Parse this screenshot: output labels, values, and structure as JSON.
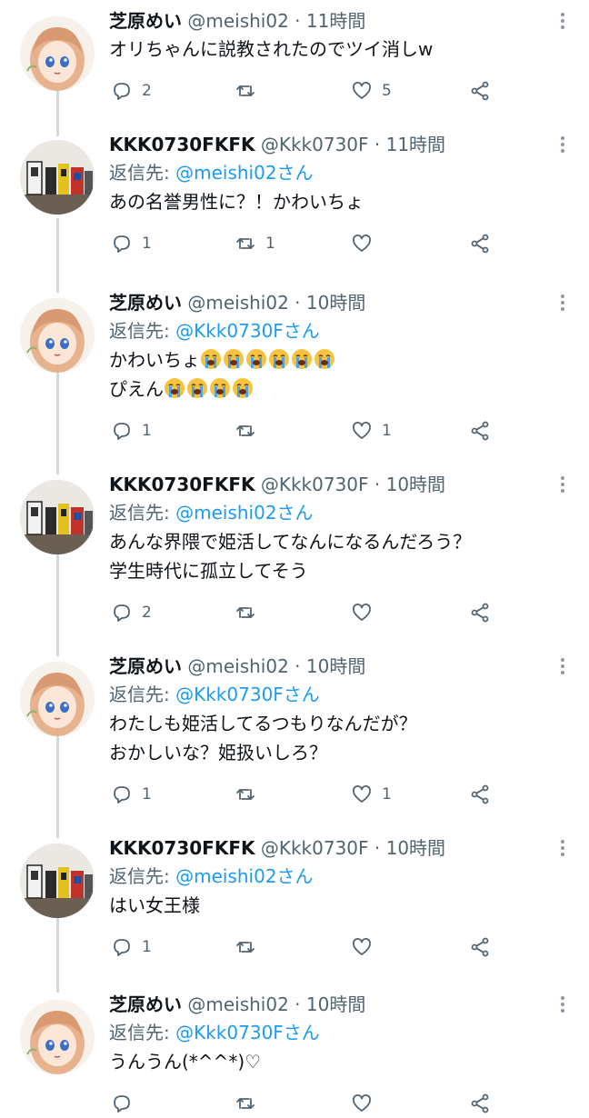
{
  "tweets": [
    {
      "name": "芝原めい",
      "handle": "@meishi02",
      "dot": "·",
      "time": "11時間",
      "reply_prefix": "",
      "reply_mention": "",
      "lines": [
        "オリちゃんに説教されたのでツイ消しw"
      ],
      "reply_count": "2",
      "retweet_count": "",
      "like_count": "5",
      "avatar": "anime-girl-avatar"
    },
    {
      "name": "KKK0730FKFK",
      "handle": "@Kkk0730F",
      "dot": "·",
      "time": "11時間",
      "reply_prefix": "返信先: ",
      "reply_mention": "@meishi02さん",
      "lines": [
        "あの名誉男性に？！かわいちょ"
      ],
      "reply_count": "1",
      "retweet_count": "1",
      "like_count": "",
      "avatar": "robot-figures-avatar"
    },
    {
      "name": "芝原めい",
      "handle": "@meishi02",
      "dot": "·",
      "time": "10時間",
      "reply_prefix": "返信先: ",
      "reply_mention": "@Kkk0730Fさん",
      "lines": [
        "かわいちょ",
        "ぴえん"
      ],
      "emoji_counts": [
        6,
        4
      ],
      "emoji_name": "loudly-crying-face",
      "reply_count": "1",
      "retweet_count": "",
      "like_count": "1",
      "avatar": "anime-girl-avatar"
    },
    {
      "name": "KKK0730FKFK",
      "handle": "@Kkk0730F",
      "dot": "·",
      "time": "10時間",
      "reply_prefix": "返信先: ",
      "reply_mention": "@meishi02さん",
      "lines": [
        "あんな界隈で姫活してなんになるんだろう？",
        "学生時代に孤立してそう"
      ],
      "reply_count": "2",
      "retweet_count": "",
      "like_count": "",
      "avatar": "robot-figures-avatar"
    },
    {
      "name": "芝原めい",
      "handle": "@meishi02",
      "dot": "·",
      "time": "10時間",
      "reply_prefix": "返信先: ",
      "reply_mention": "@Kkk0730Fさん",
      "lines": [
        "わたしも姫活してるつもりなんだが？",
        "おかしいな？姫扱いしろ？"
      ],
      "reply_count": "1",
      "retweet_count": "",
      "like_count": "1",
      "avatar": "anime-girl-avatar"
    },
    {
      "name": "KKK0730FKFK",
      "handle": "@Kkk0730F",
      "dot": "·",
      "time": "10時間",
      "reply_prefix": "返信先: ",
      "reply_mention": "@meishi02さん",
      "lines": [
        "はい女王様"
      ],
      "reply_count": "1",
      "retweet_count": "",
      "like_count": "",
      "avatar": "robot-figures-avatar"
    },
    {
      "name": "芝原めい",
      "handle": "@meishi02",
      "dot": "·",
      "time": "10時間",
      "reply_prefix": "返信先: ",
      "reply_mention": "@Kkk0730Fさん",
      "lines": [
        "うんうん(*^^*)♡"
      ],
      "reply_count": "",
      "retweet_count": "",
      "like_count": "",
      "avatar": "anime-girl-avatar"
    }
  ],
  "icons": {
    "reply": "reply-icon",
    "retweet": "retweet-icon",
    "like": "heart-icon",
    "share": "share-icon",
    "more": "more-options-icon"
  },
  "colors": {
    "link": "#1d9bf0",
    "muted": "#536471",
    "thread_line": "#cfd9de"
  }
}
